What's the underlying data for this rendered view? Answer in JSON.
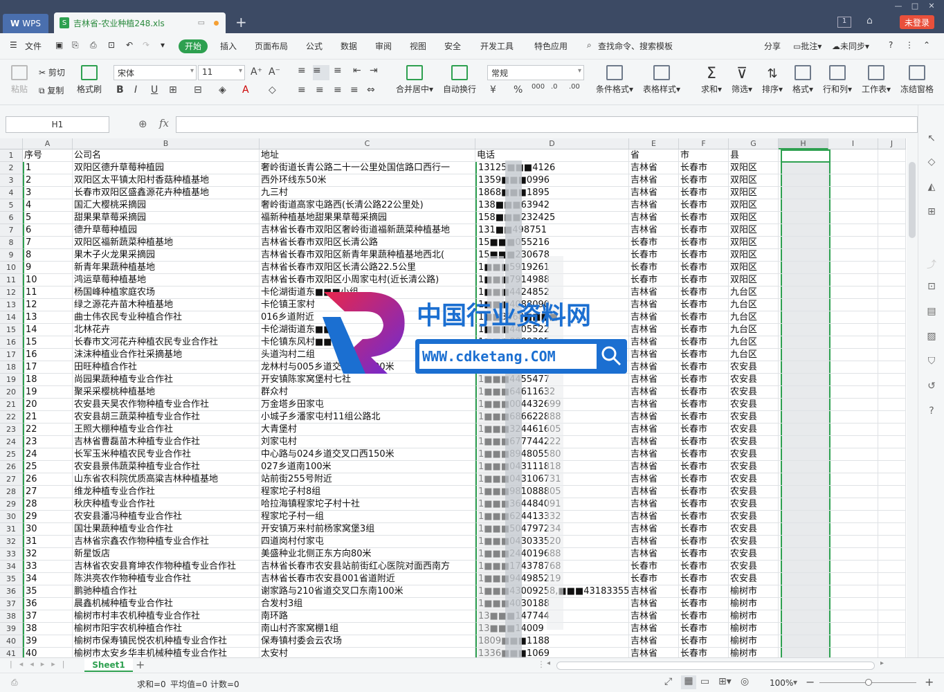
{
  "titlebar": {
    "app": "WPS",
    "doc_tab": "吉林省-农业种植248.xls",
    "sheet_count": "1",
    "login": "未登录"
  },
  "menu": {
    "items": [
      "文件",
      "开始",
      "插入",
      "页面布局",
      "公式",
      "数据",
      "审阅",
      "视图",
      "安全",
      "开发工具",
      "特色应用"
    ],
    "search": "查找命令、搜索模板",
    "right": [
      "分享",
      "批注",
      "未同步"
    ]
  },
  "ribbon": {
    "paste": "粘贴",
    "cut": "剪切",
    "copy": "复制",
    "format_painter": "格式刷",
    "font": "宋体",
    "size": "11",
    "merge": "合并居中",
    "wrap": "自动换行",
    "numfmt": "常规",
    "cond": "条件格式",
    "table_style": "表格样式",
    "sum": "求和",
    "filter": "筛选",
    "sort": "排序",
    "format": "格式",
    "rowcol": "行和列",
    "worksheet": "工作表",
    "freeze": "冻结窗格"
  },
  "formula_bar": {
    "cell_ref": "H1",
    "fx": "fx"
  },
  "columns": [
    "A",
    "B",
    "C",
    "D",
    "E",
    "F",
    "G",
    "H",
    "I",
    "J"
  ],
  "header": [
    "序号",
    "公司名",
    "地址",
    "电话",
    "省",
    "市",
    "县"
  ],
  "rows": [
    [
      "1",
      "双阳区德升草莓种植园",
      "奢岭街道长青公路二十一公里处国信路口西行一",
      "13125■■■4126",
      "吉林省",
      "长春市",
      "双阳区"
    ],
    [
      "2",
      "双阳区太平镇太阳村香菇种植基地",
      "西外环线东50米",
      "1359■■■0996",
      "吉林省",
      "长春市",
      "双阳区"
    ],
    [
      "3",
      "长春市双阳区盛鑫源花卉种植基地",
      "九三村",
      "1868■■■1895",
      "吉林省",
      "长春市",
      "双阳区"
    ],
    [
      "4",
      "国汇大樱桃采摘园",
      "奢岭街道高家屯路西(长清公路22公里处)",
      "138■■■63942",
      "吉林省",
      "长春市",
      "双阳区"
    ],
    [
      "5",
      "甜果果草莓采摘园",
      "福新种植基地甜果果草莓采摘园",
      "158■■■232425",
      "吉林省",
      "长春市",
      "双阳区"
    ],
    [
      "6",
      "德升草莓种植园",
      "吉林省长春市双阳区奢岭街道福新蔬菜种植基地",
      "131■■498751",
      "吉林省",
      "长春市",
      "双阳区"
    ],
    [
      "7",
      "双阳区福新蔬菜种植基地",
      "吉林省长春市双阳区长清公路",
      "15■■■055216",
      "长春市",
      "长春市",
      "双阳区"
    ],
    [
      "8",
      "果木子火龙果采摘园",
      "吉林省长春市双阳区新青年果蔬种植基地西北(",
      "15■■■230678",
      "长春市",
      "长春市",
      "双阳区"
    ],
    [
      "9",
      "新青年果蔬种植基地",
      "吉林省长春市双阳区长清公路22.5公里",
      "1■■■5919261",
      "长春市",
      "长春市",
      "双阳区"
    ],
    [
      "10",
      "鸿运草莓种植基地",
      "吉林省长春市双阳区小周家屯村(近长清公路)",
      "1■■■7914988",
      "长春市",
      "长春市",
      "双阳区"
    ],
    [
      "11",
      "杨国峰种植家庭农场",
      "卡伦湖街道东■■■小组",
      "1■■■4424852",
      "吉林省",
      "长春市",
      "九台区"
    ],
    [
      "12",
      "绿之源花卉苗木种植基地",
      "卡伦镇王家村",
      "1■■■4088090",
      "吉林省",
      "长春市",
      "九台区"
    ],
    [
      "13",
      "曲士伟农民专业种植合作社",
      "016乡道附近",
      "1■■3068■■■■",
      "吉林省",
      "长春市",
      "九台区"
    ],
    [
      "14",
      "北林花卉",
      "卡伦湖街道东■■■",
      "1■■■4405522",
      "吉林省",
      "长春市",
      "九台区"
    ],
    [
      "15",
      "长春市文河花卉种植农民专业合作社",
      "卡伦镇东风村■■■",
      "1■■■8889395",
      "吉林省",
      "长春市",
      "九台区"
    ],
    [
      "16",
      "沫沫种植业合作社采摘基地",
      "头道沟村二组",
      "1■■■8889395",
      "吉林省",
      "长春市",
      "九台区"
    ],
    [
      "17",
      "田旺种植合作社",
      "龙林村与005乡道交叉口北100米",
      "1■■■6625477",
      "吉林省",
      "长春市",
      "农安县"
    ],
    [
      "18",
      "尚园果蔬种植专业合作社",
      "开安镇陈家窝堡村七社",
      "1■■■4455477",
      "吉林省",
      "长春市",
      "农安县"
    ],
    [
      "19",
      "聚采采樱桃种植基地",
      "群众村",
      "1■■■64611632",
      "吉林省",
      "长春市",
      "农安县"
    ],
    [
      "20",
      "农安县天昊农作物种植专业合作社",
      "万金塔乡田家屯",
      "1■■■004432699",
      "吉林省",
      "长春市",
      "农安县"
    ],
    [
      "21",
      "农安县胡三蔬菜种植专业合作社",
      "小城子乡潘家屯村11组公路北",
      "1■■■686622888",
      "吉林省",
      "长春市",
      "农安县"
    ],
    [
      "22",
      "王照大棚种植专业合作社",
      "大青堡村",
      "1■■■324461605",
      "吉林省",
      "长春市",
      "农安县"
    ],
    [
      "23",
      "吉林省曹磊苗木种植专业合作社",
      "刘家屯村",
      "1■■■677744222",
      "吉林省",
      "长春市",
      "农安县"
    ],
    [
      "24",
      "长军玉米种植农民专业合作社",
      "中心路与024乡道交叉口西150米",
      "1■■■894805580",
      "吉林省",
      "长春市",
      "农安县"
    ],
    [
      "25",
      "农安县景伟蔬菜种植专业合作社",
      "027乡道南100米",
      "1■■■043111818",
      "吉林省",
      "长春市",
      "农安县"
    ],
    [
      "26",
      "山东省农科院优质高粱吉林种植基地",
      "站前街255号附近",
      "1■■■043106731",
      "吉林省",
      "长春市",
      "农安县"
    ],
    [
      "27",
      "维龙种植专业合作社",
      "程家坨子村8组",
      "1■■■981088805",
      "吉林省",
      "长春市",
      "农安县"
    ],
    [
      "28",
      "秋庆种植专业合作社",
      "哈拉海镇程家坨子村十社",
      "1■■■364484091",
      "吉林省",
      "长春市",
      "农安县"
    ],
    [
      "29",
      "农安县潘冯种植专业合作社",
      "程家坨子村一组",
      "1■■■624413332",
      "吉林省",
      "长春市",
      "农安县"
    ],
    [
      "30",
      "国壮果蔬种植专业合作社",
      "开安镇万来村前杨家窝堡3组",
      "1■■■504797234",
      "吉林省",
      "长春市",
      "农安县"
    ],
    [
      "31",
      "吉林省宗鑫农作物种植专业合作社",
      "四道岗村付家屯",
      "1■■■043033520",
      "吉林省",
      "长春市",
      "农安县"
    ],
    [
      "32",
      "新星饭店",
      "美盛种业北侧正东方向80米",
      "1■■■244019688",
      "吉林省",
      "长春市",
      "农安县"
    ],
    [
      "33",
      "吉林省农安县育坤农作物种植专业合作社",
      "吉林省长春市农安县站前街红心医院对面西南方",
      "1■■■174378768",
      "长春市",
      "长春市",
      "农安县"
    ],
    [
      "34",
      "陈洪亮农作物种植专业合作社",
      "吉林省长春市农安县001省道附近",
      "1■■■944985219",
      "长春市",
      "长春市",
      "农安县"
    ],
    [
      "35",
      "鹏驰种植合作社",
      "谢家路与210省道交叉口东南100米",
      "1■■■43009258,■■■43183355",
      "吉林省",
      "长春市",
      "榆树市"
    ],
    [
      "36",
      "晨鑫机械种植专业合作社",
      "合发村3组",
      "1■■■4030188",
      "吉林省",
      "长春市",
      "榆树市"
    ],
    [
      "37",
      "榆树市村丰农机种植专业合作社",
      "南环路",
      "13■■■147744",
      "吉林省",
      "长春市",
      "榆树市"
    ],
    [
      "38",
      "榆树市阳宇农机种植合作社",
      "南山村齐家窝棚1组",
      "13■■■14009",
      "吉林省",
      "长春市",
      "榆树市"
    ],
    [
      "39",
      "榆树市保寿镇民悦农机种植专业合作社",
      "保寿镇村委会云农场",
      "1809■■■1188",
      "吉林省",
      "长春市",
      "榆树市"
    ],
    [
      "40",
      "榆树市太安乡华丰机械种植专业合作社",
      "太安村",
      "1336■■■1069",
      "吉林省",
      "长春市",
      "榆树市"
    ]
  ],
  "sheet": {
    "tab": "Sheet1"
  },
  "status": {
    "sum": "求和=0",
    "avg": "平均值=0",
    "count": "计数=0",
    "zoom": "100%"
  },
  "watermark": {
    "title": "中国行业资料网",
    "url": "WWW.cdketang.COM"
  },
  "colors": {
    "accent": "#2ea050",
    "titlebar": "#3c4a64",
    "login": "#e9503b"
  }
}
